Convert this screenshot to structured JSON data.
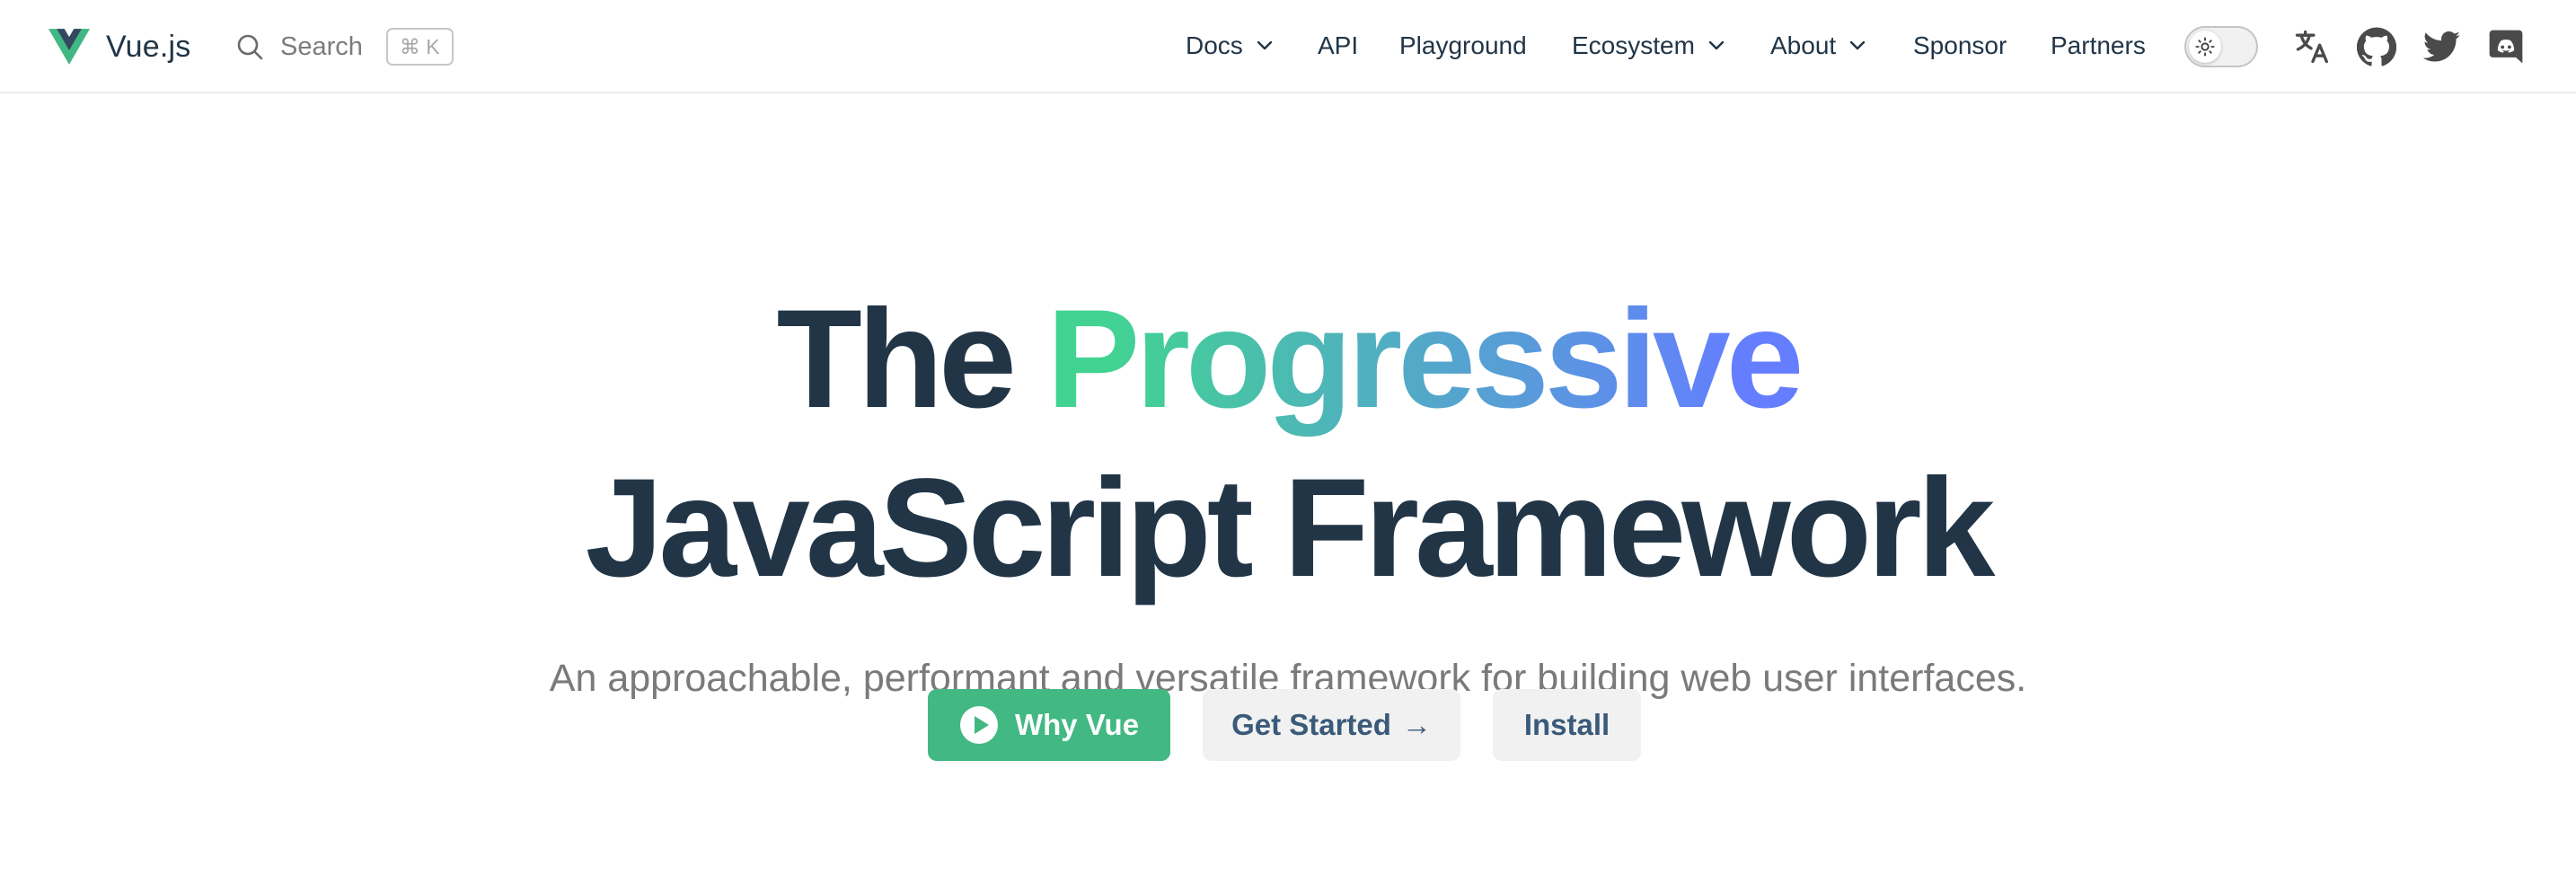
{
  "brand": {
    "name": "Vue.js",
    "logo_icon": "vue-logo",
    "colors": {
      "green": "#42b883",
      "navy": "#35495e"
    }
  },
  "search": {
    "label": "Search",
    "shortcut": "⌘ K",
    "icon": "search-icon"
  },
  "nav": {
    "items": [
      {
        "label": "Docs",
        "dropdown": true
      },
      {
        "label": "API",
        "dropdown": false
      },
      {
        "label": "Playground",
        "dropdown": false
      },
      {
        "label": "Ecosystem",
        "dropdown": true
      },
      {
        "label": "About",
        "dropdown": true
      },
      {
        "label": "Sponsor",
        "dropdown": false
      },
      {
        "label": "Partners",
        "dropdown": false
      }
    ],
    "theme_toggle": {
      "state": "light",
      "icon": "sun-icon"
    },
    "social_icons": [
      "translate-icon",
      "github-icon",
      "twitter-icon",
      "discord-icon"
    ]
  },
  "hero": {
    "title_the": "The",
    "title_accent": "Progressive",
    "title_line2": "JavaScript Framework",
    "gradient": [
      "#42d392",
      "#647eff"
    ],
    "tagline": "An approachable, performant and versatile framework for building web user interfaces.",
    "buttons": {
      "primary": {
        "label": "Why Vue",
        "icon": "play-icon",
        "color": "#42b883"
      },
      "secondary": {
        "label": "Get Started",
        "arrow": "→"
      },
      "tertiary": {
        "label": "Install"
      }
    }
  }
}
